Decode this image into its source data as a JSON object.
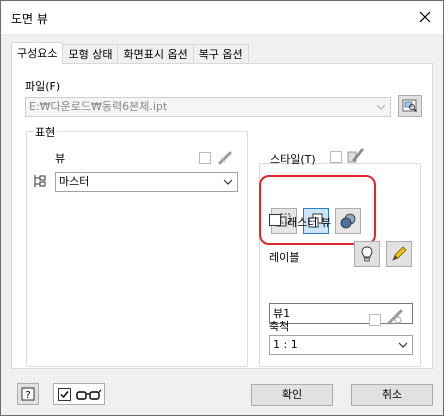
{
  "window": {
    "title": "도면 뷰"
  },
  "tabs": [
    {
      "label": "구성요소",
      "active": true
    },
    {
      "label": "모형 상태",
      "active": false
    },
    {
      "label": "화면표시 옵션",
      "active": false
    },
    {
      "label": "복구 옵션",
      "active": false
    }
  ],
  "file": {
    "label": "파일(F)",
    "path": "E:₩다운로드₩동력6본체.ipt"
  },
  "representation": {
    "group_title": "표현",
    "view_label": "뷰",
    "view_value": "마스터"
  },
  "style": {
    "label": "스타일(T)",
    "buttons": [
      "hidden-line-icon",
      "hidden-line-removed-icon",
      "shaded-icon"
    ],
    "selected_index": 1,
    "highlight_color": "#e0262e"
  },
  "raster": {
    "label": "래스터 뷰"
  },
  "view_label": {
    "label": "레이블",
    "value": "뷰1"
  },
  "scale": {
    "label": "축척",
    "value": "1 : 1"
  },
  "footer": {
    "ok_label": "확인",
    "cancel_label": "취소"
  },
  "colors": {
    "selected_button": "#cce4f7",
    "selected_border": "#2a7fd4"
  }
}
